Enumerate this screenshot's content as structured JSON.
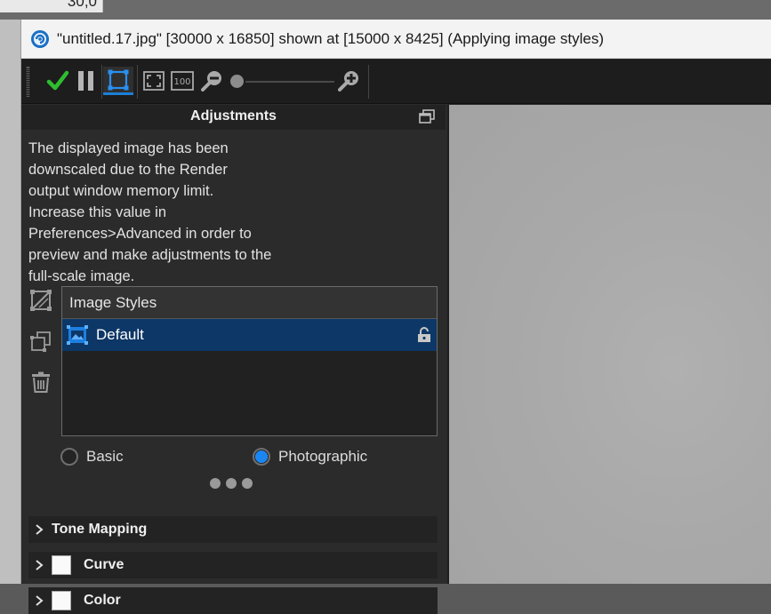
{
  "background": {
    "cell_value": "30,0"
  },
  "window": {
    "title": "\"untitled.17.jpg\" [30000 x 16850] shown at [15000 x 8425] (Applying image styles)"
  },
  "toolbar": {
    "buttons": [
      {
        "name": "apply-check",
        "icon": "check-icon"
      },
      {
        "name": "pause",
        "icon": "pause-icon"
      },
      {
        "name": "region",
        "icon": "region-select-icon",
        "active": true
      },
      {
        "name": "fit",
        "icon": "fit-to-window-icon"
      },
      {
        "name": "actual-size",
        "icon": "actual-size-icon",
        "label": "100"
      },
      {
        "name": "zoom-out",
        "icon": "zoom-out-icon"
      },
      {
        "name": "zoom-in",
        "icon": "zoom-in-icon"
      }
    ],
    "zoom_slider": 0.0
  },
  "adjustments": {
    "title": "Adjustments",
    "info_lines": [
      "The displayed image has been",
      "downscaled due to the Render",
      "output window memory limit.",
      "Increase this value in",
      "Preferences>Advanced in order to",
      "preview and make adjustments to the",
      "full-scale image."
    ],
    "styles_header": "Image Styles",
    "styles": [
      {
        "label": "Default",
        "selected": true,
        "locked": true
      }
    ],
    "mode_options": [
      {
        "label": "Basic",
        "selected": false
      },
      {
        "label": "Photographic",
        "selected": true
      }
    ],
    "sections": [
      {
        "label": "Tone Mapping",
        "has_checkbox": false
      },
      {
        "label": "Curve",
        "has_checkbox": true
      },
      {
        "label": "Color",
        "has_checkbox": true
      }
    ]
  },
  "colors": {
    "accent": "#1b86f2",
    "check_green": "#2fbd2f",
    "selection": "#0d3766"
  }
}
